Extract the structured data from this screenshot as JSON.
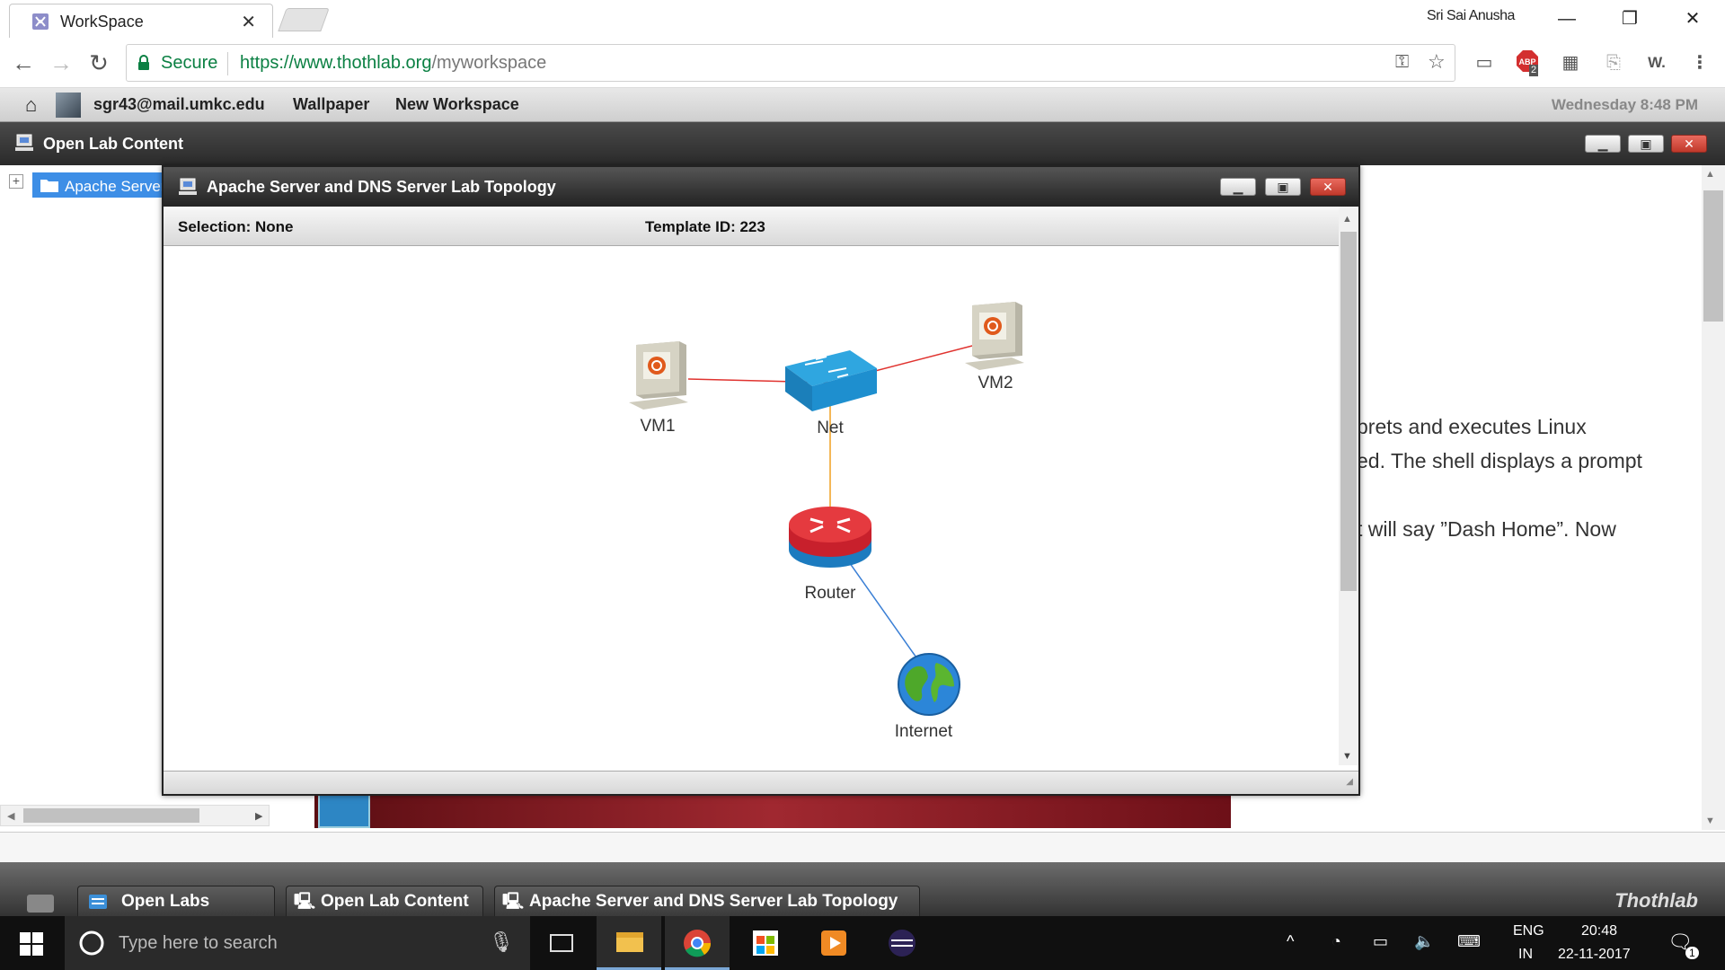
{
  "browser": {
    "tab_title": "WorkSpace",
    "profile_name": "Sri Sai Anusha",
    "security_label": "Secure",
    "url_host": "https://www.thothlab.org",
    "url_path": "/myworkspace",
    "abp_badge": "2",
    "ext_w_label": "W."
  },
  "thothlab_bar": {
    "user_email": "sgr43@mail.umkc.edu",
    "wallpaper_label": "Wallpaper",
    "new_workspace_label": "New Workspace",
    "clock": "Wednesday 8:48 PM"
  },
  "open_lab_window": {
    "title": "Open Lab Content",
    "tree_item": "Apache Server",
    "content_lines": [
      "prets and executes Linux",
      "ed. The shell displays a prompt",
      "",
      "t will say ”Dash Home”. Now"
    ]
  },
  "topology_dialog": {
    "title": "Apache Server and DNS Server Lab Topology",
    "selection_label": "Selection: None",
    "template_label": "Template ID: 223",
    "nodes": {
      "vm1": "VM1",
      "vm2": "VM2",
      "net": "Net",
      "router": "Router",
      "internet": "Internet"
    },
    "link_colors": {
      "vm_links": "#e0332f",
      "net_router": "#f0a020",
      "router_internet": "#3a7fd5"
    }
  },
  "thothlab_taskbar": {
    "tabs": [
      "Open Labs",
      "Open Lab Content",
      "Apache Server and DNS Server Lab Topology"
    ],
    "brand": "Thothlab"
  },
  "windows_taskbar": {
    "search_placeholder": "Type here to search",
    "lang_top": "ENG",
    "lang_bottom": "IN",
    "time": "20:48",
    "date": "22-11-2017",
    "notification_count": "1"
  }
}
